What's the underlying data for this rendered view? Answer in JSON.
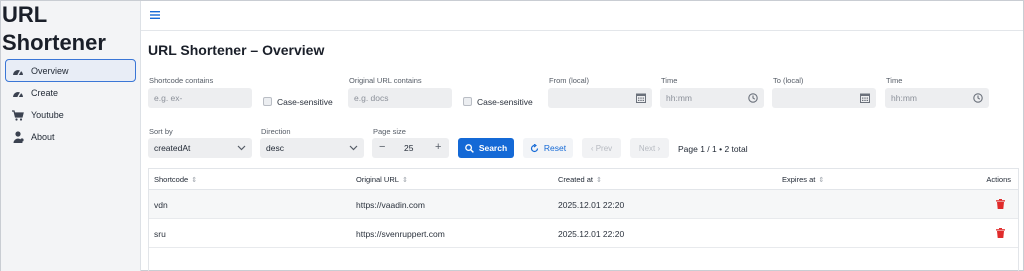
{
  "app": {
    "title_line1": "URL",
    "title_line2": "Shortener"
  },
  "sidebar": {
    "items": [
      {
        "label": "Overview",
        "icon": "gauge-icon",
        "active": true
      },
      {
        "label": "Create",
        "icon": "gauge-icon"
      },
      {
        "label": "Youtube",
        "icon": "cart-icon"
      },
      {
        "label": "About",
        "icon": "user-icon"
      }
    ]
  },
  "header": {
    "title": "URL Shortener – Overview"
  },
  "filters": {
    "shortcode_label": "Shortcode contains",
    "shortcode_placeholder": "e.g. ex-",
    "case_label_1": "Case-sensitive",
    "original_label": "Original URL contains",
    "original_placeholder": "e.g. docs",
    "case_label_2": "Case-sensitive",
    "from_label": "From (local)",
    "time_label_1": "Time",
    "time_placeholder_1": "hh:mm",
    "to_label": "To (local)",
    "time_label_2": "Time",
    "time_placeholder_2": "hh:mm"
  },
  "controls": {
    "sort_label": "Sort by",
    "sort_value": "createdAt",
    "direction_label": "Direction",
    "direction_value": "desc",
    "pagesize_label": "Page size",
    "pagesize_minus": "−",
    "pagesize_value": "25",
    "pagesize_plus": "+",
    "search_label": "Search",
    "reset_label": "Reset",
    "prev_label": "‹ Prev",
    "next_label": "Next ›",
    "page_info": "Page 1 / 1 • 2 total"
  },
  "table": {
    "columns": [
      "Shortcode",
      "Original URL",
      "Created at",
      "Expires at",
      "Actions"
    ],
    "sort_glyph": "⇕",
    "rows": [
      {
        "shortcode": "vdn",
        "original_url": "https://vaadin.com",
        "created_at": "2025.12.01 22:20",
        "expires_at": ""
      },
      {
        "shortcode": "sru",
        "original_url": "https://svenruppert.com",
        "created_at": "2025.12.01 22:20",
        "expires_at": ""
      }
    ]
  },
  "colors": {
    "primary": "#1469d6",
    "danger": "#e02b2b",
    "sidebar_bg": "#f3f4f6",
    "input_bg": "#edeef0"
  }
}
